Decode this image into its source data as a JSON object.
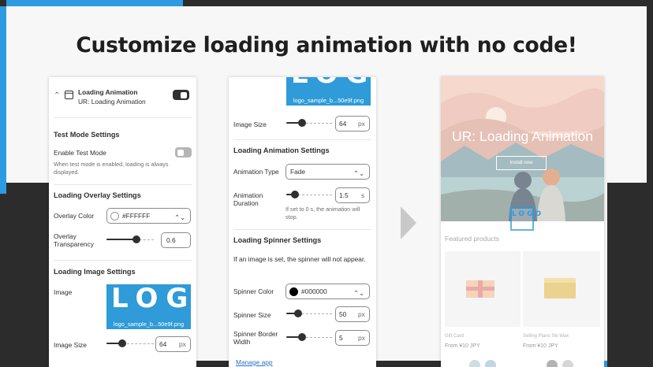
{
  "headline": "Customize loading animation with no code!",
  "left_panel": {
    "app_title": "Loading Animation",
    "app_subtitle": "UR: Loading Animation",
    "test_mode_heading": "Test Mode Settings",
    "enable_test_mode_label": "Enable Test Mode",
    "enable_test_mode_help": "When test mode is enabled, loading is always displayed.",
    "overlay_heading": "Loading Overlay Settings",
    "overlay_color_label": "Overlay Color",
    "overlay_color_value": "#FFFFFF",
    "overlay_transparency_label": "Overlay Transparency",
    "overlay_transparency_value": "0.6",
    "overlay_transparency_fraction": 0.6,
    "image_heading": "Loading Image Settings",
    "image_label": "Image",
    "image_logo_letters": "LOGO",
    "image_filename": "logo_sample_b...50e9f.png",
    "image_size_label": "Image Size",
    "image_size_value": "64",
    "image_size_unit": "px"
  },
  "middle_panel": {
    "image_logo_letters": "LOGO",
    "image_filename": "logo_sample_b...50e9f.png",
    "image_size_label": "Image Size",
    "image_size_value": "64",
    "image_size_unit": "px",
    "animation_heading": "Loading Animation Settings",
    "animation_type_label": "Animation Type",
    "animation_type_value": "Fade",
    "animation_duration_label": "Animation Duration",
    "animation_duration_value": "1.5",
    "animation_duration_unit": "s",
    "animation_duration_help": "If set to 0 s, the animation will stop.",
    "spinner_heading": "Loading Spinner Settings",
    "spinner_note": "If an image is set, the spinner will not appear.",
    "spinner_color_label": "Spinner Color",
    "spinner_color_value": "#000000",
    "spinner_size_label": "Spinner Size",
    "spinner_size_value": "50",
    "spinner_size_unit": "px",
    "spinner_border_label": "Spinner Border Width",
    "spinner_border_value": "5",
    "spinner_border_unit": "px",
    "manage_app_link": "Manage app"
  },
  "storefront": {
    "hero_title": "UR: Loading Animation",
    "hero_button": "Install now",
    "logo_letters": "LOGO",
    "featured_heading": "Featured products",
    "products": [
      {
        "name": "Gift Card",
        "price": "From ¥10 JPY"
      },
      {
        "name": "Selling Plans Ski Wax",
        "price": "From ¥10 JPY"
      }
    ]
  },
  "colors": {
    "accent_blue": "#2d9be0",
    "frame_dark": "#2c2c2c",
    "overlay_white": "#FFFFFF",
    "spinner_black": "#000000"
  }
}
